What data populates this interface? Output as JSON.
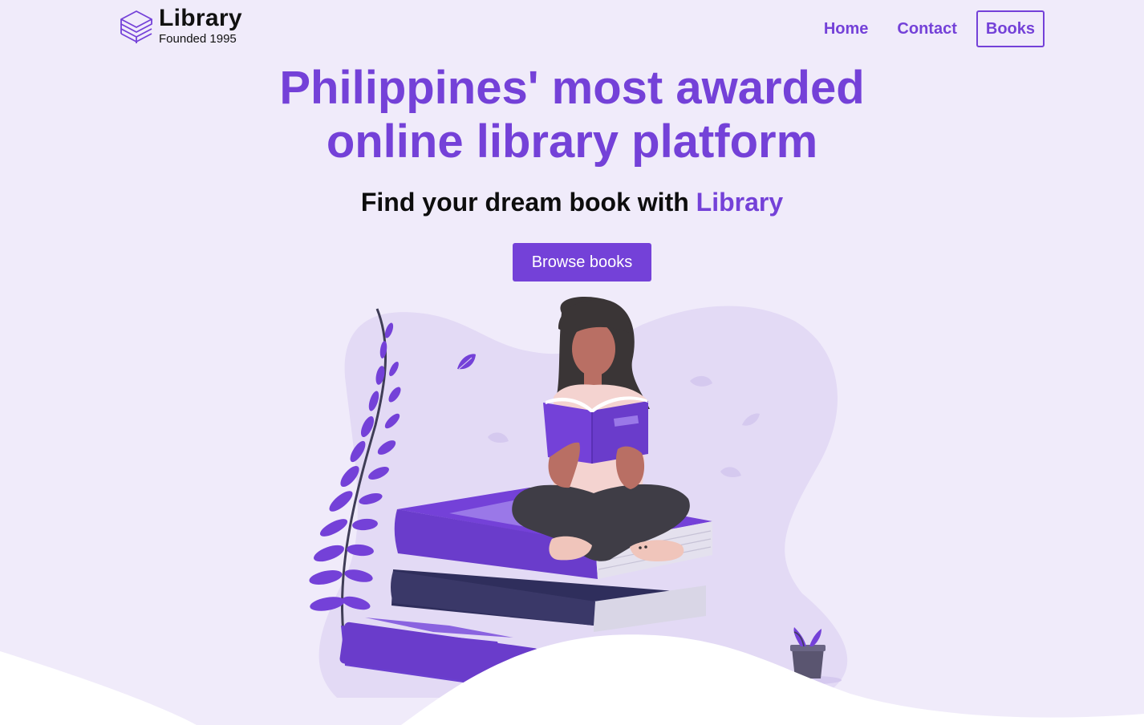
{
  "brand": {
    "title": "Library",
    "subtitle": "Founded 1995"
  },
  "nav": {
    "home": "Home",
    "contact": "Contact",
    "books": "Books",
    "active": "Books"
  },
  "hero": {
    "title_line1": "Philippines' most awarded",
    "title_line2": "online library platform",
    "subtitle_prefix": "Find your dream book with",
    "subtitle_brand": "Library",
    "cta": "Browse books"
  },
  "colors": {
    "accent": "#7441d8",
    "background": "#f0ebfa",
    "blob": "#e3daf5",
    "book_dark": "#2f2e5c",
    "text": "#0d0d0d"
  },
  "icons": {
    "logo": "stacked-books-icon"
  }
}
